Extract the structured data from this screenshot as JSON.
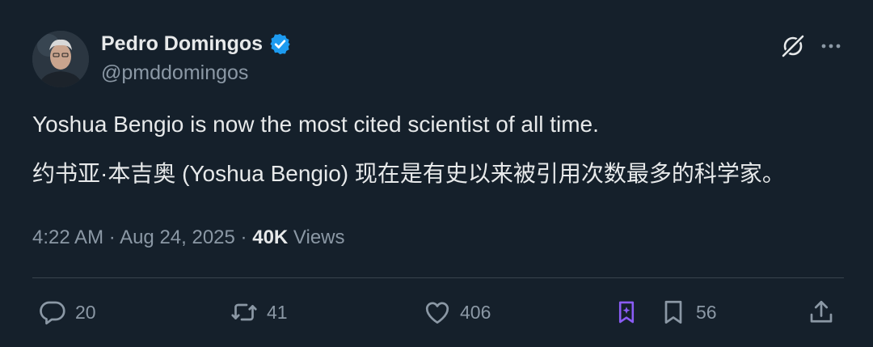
{
  "author": {
    "display_name": "Pedro Domingos",
    "handle": "@pmddomingos",
    "verified": true
  },
  "tweet": {
    "text_en": "Yoshua Bengio is now the most cited scientist of all time.",
    "text_zh": "约书亚·本吉奥 (Yoshua Bengio) 现在是有史以来被引用次数最多的科学家。",
    "time": "4:22 AM",
    "date": "Aug 24, 2025",
    "views_count": "40K",
    "views_label": "Views"
  },
  "actions": {
    "replies": "20",
    "retweets": "41",
    "likes": "406",
    "bookmarks": "56"
  },
  "colors": {
    "background": "#15202b",
    "text": "#e7e9ea",
    "muted": "#8b98a5",
    "verified_blue": "#1d9bf0",
    "grok_purple": "#8b5cf6",
    "divider": "#38444d"
  },
  "icons": [
    "verified-badge-icon",
    "grok-icon",
    "more-icon",
    "reply-icon",
    "retweet-icon",
    "like-icon",
    "grok-analyze-icon",
    "bookmark-icon",
    "share-icon"
  ]
}
